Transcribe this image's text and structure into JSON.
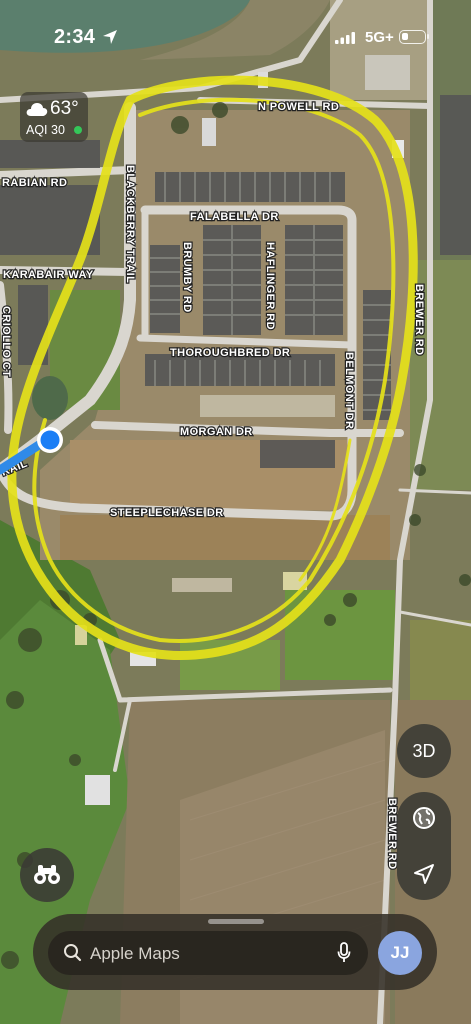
{
  "status_bar": {
    "time": "2:34",
    "network": "5G+"
  },
  "weather": {
    "temperature": "63°",
    "aqi": "AQI 30",
    "icon": "cloud-icon",
    "aqi_color": "#34c759"
  },
  "map": {
    "streets": {
      "n_powell": "N POWELL RD",
      "arabian": "RABIAN RD",
      "karabair": "KARABAIR WAY",
      "criollo": "CRIOLLO CT",
      "blackberry": "BLACKBERRY TRAIL",
      "falabella": "FALABELLA DR",
      "brumby": "BRUMBY RD",
      "haflinger": "HAFLINGER RD",
      "thoroughbred": "THOROUGHBRED DR",
      "belmont": "BELMONT DR",
      "brewer_top": "BREWER RD",
      "morgan": "MORGAN DR",
      "trail": "RAIL",
      "steeplechase": "STEEPLECHASE DR",
      "brewer_bottom": "BREWER RD"
    },
    "highlight_color": "#e5e11a",
    "location_dot_color": "#1a7ef5"
  },
  "controls": {
    "view_3d": "3D",
    "globe_icon": "globe-icon",
    "navigation_icon": "location-arrow-icon",
    "binoculars_icon": "binoculars-icon"
  },
  "search": {
    "placeholder": "Apple Maps",
    "search_icon": "search-icon",
    "mic_icon": "microphone-icon"
  },
  "profile": {
    "initials": "JJ"
  }
}
